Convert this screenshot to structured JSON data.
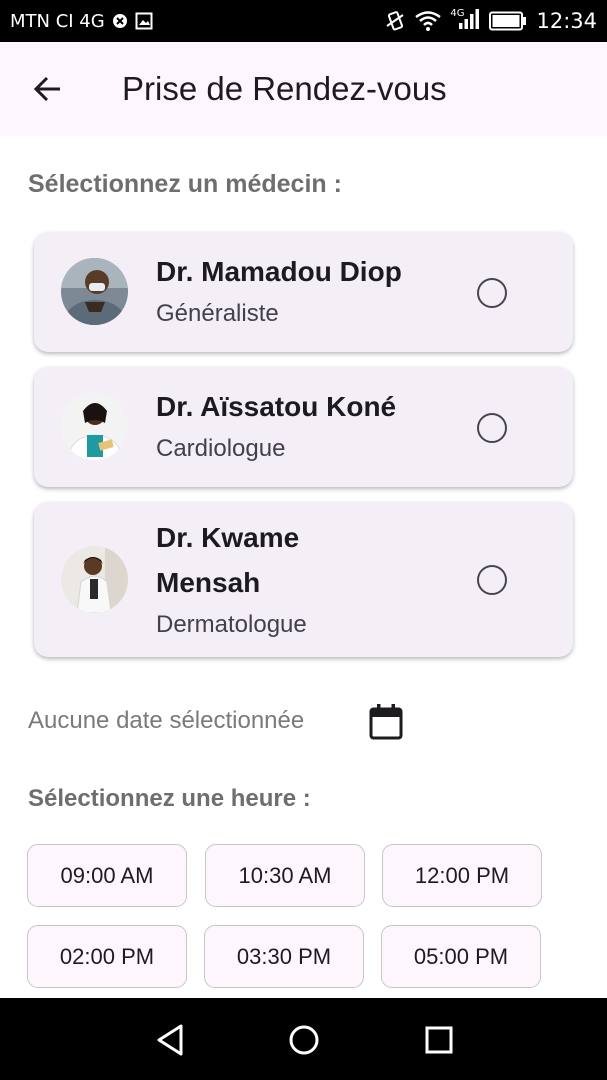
{
  "status_bar": {
    "carrier": "MTN CI 4G",
    "network_label": "4G",
    "time": "12:34",
    "icons": [
      "blocked-circle-icon",
      "image-icon",
      "vibrate-icon",
      "wifi-icon",
      "signal-icon",
      "battery-icon"
    ]
  },
  "app_bar": {
    "title": "Prise de Rendez-vous",
    "back_icon": "arrow-left-icon"
  },
  "doctor_section": {
    "label": "Sélectionnez un médecin :",
    "doctors": [
      {
        "name": "Dr. Mamadou Diop",
        "specialty": "Généraliste",
        "selected": false
      },
      {
        "name": "Dr. Aïssatou Koné",
        "specialty": "Cardiologue",
        "selected": false
      },
      {
        "name_line1": "Dr. Kwame",
        "name_line2": "Mensah",
        "specialty": "Dermatologue",
        "selected": false
      }
    ]
  },
  "date": {
    "text": "Aucune date sélectionnée",
    "icon": "calendar-icon"
  },
  "time_section": {
    "label": "Sélectionnez une heure :",
    "slots": [
      "09:00 AM",
      "10:30 AM",
      "12:00 PM",
      "02:00 PM",
      "03:30 PM",
      "05:00 PM"
    ]
  },
  "nav_bar": {
    "icons": [
      "back-triangle-icon",
      "home-circle-icon",
      "recents-square-icon"
    ]
  },
  "colors": {
    "app_bar_bg": "#fdf7fd",
    "card_bg": "#f4eff7",
    "label_gray": "#6e6e6e",
    "chip_border": "#c9c4cc"
  }
}
